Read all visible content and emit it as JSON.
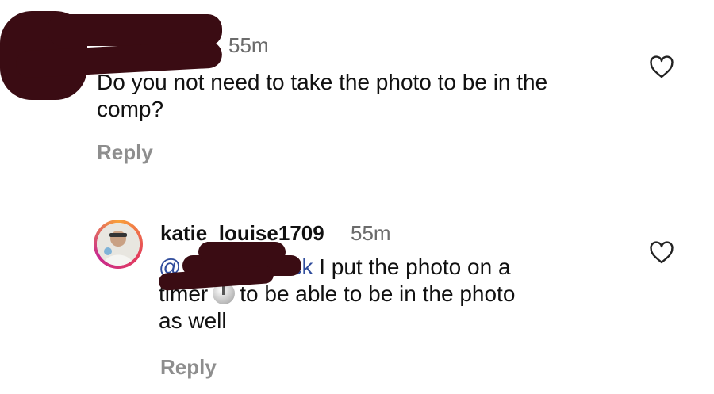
{
  "comment_1": {
    "time": "55m",
    "text": "Do you not need to take the photo to be in the comp?",
    "reply_label": "Reply",
    "like_icon": "heart-outline-icon"
  },
  "comment_2": {
    "username": "katie_louise1709",
    "time": "55m",
    "mention_prefix": "@",
    "mention_suffix": "ck",
    "text_line1": " I put the photo on a",
    "text_line2a": "timer",
    "timer_icon": "timer-clock-icon",
    "text_line2b": "to be able to be in the photo",
    "text_line3": "as well",
    "reply_label": "Reply",
    "like_icon": "heart-outline-icon"
  },
  "colors": {
    "text": "#111111",
    "meta": "#8e8e8e",
    "mention": "#2f4c9c",
    "redaction": "#3a0c13"
  }
}
